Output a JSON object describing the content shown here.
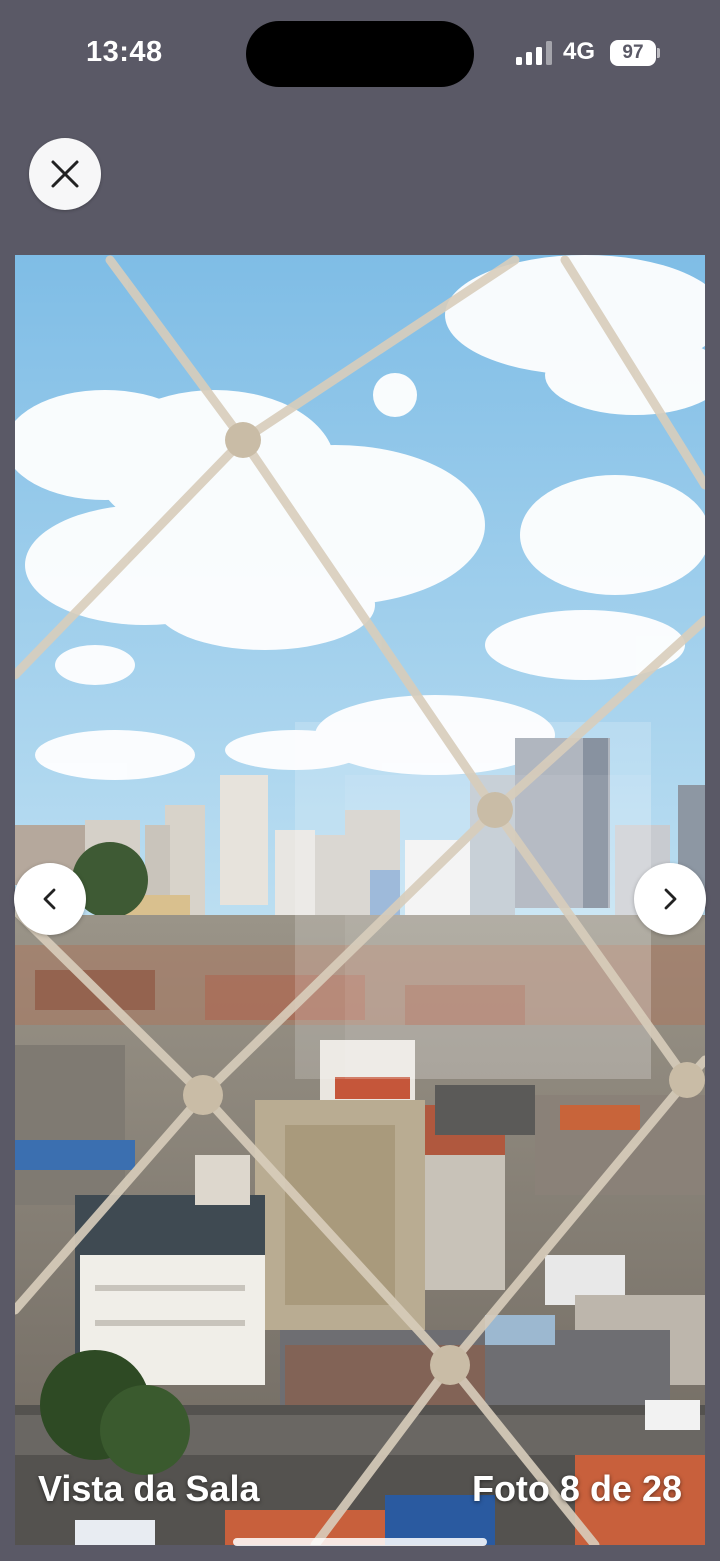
{
  "status": {
    "time": "13:48",
    "network": "4G",
    "battery": "97"
  },
  "icons": {
    "close": "close-icon",
    "prev": "chevron-left-icon",
    "next": "chevron-right-icon",
    "signal": "signal-bars-icon",
    "battery": "battery-icon"
  },
  "photo": {
    "subject": "city view through safety net"
  },
  "caption": {
    "title": "Vista da Sala",
    "counter": "Foto 8 de 28"
  },
  "colors": {
    "background": "#5a5966",
    "sky": "#8fc3e3",
    "button": "#ffffff"
  }
}
